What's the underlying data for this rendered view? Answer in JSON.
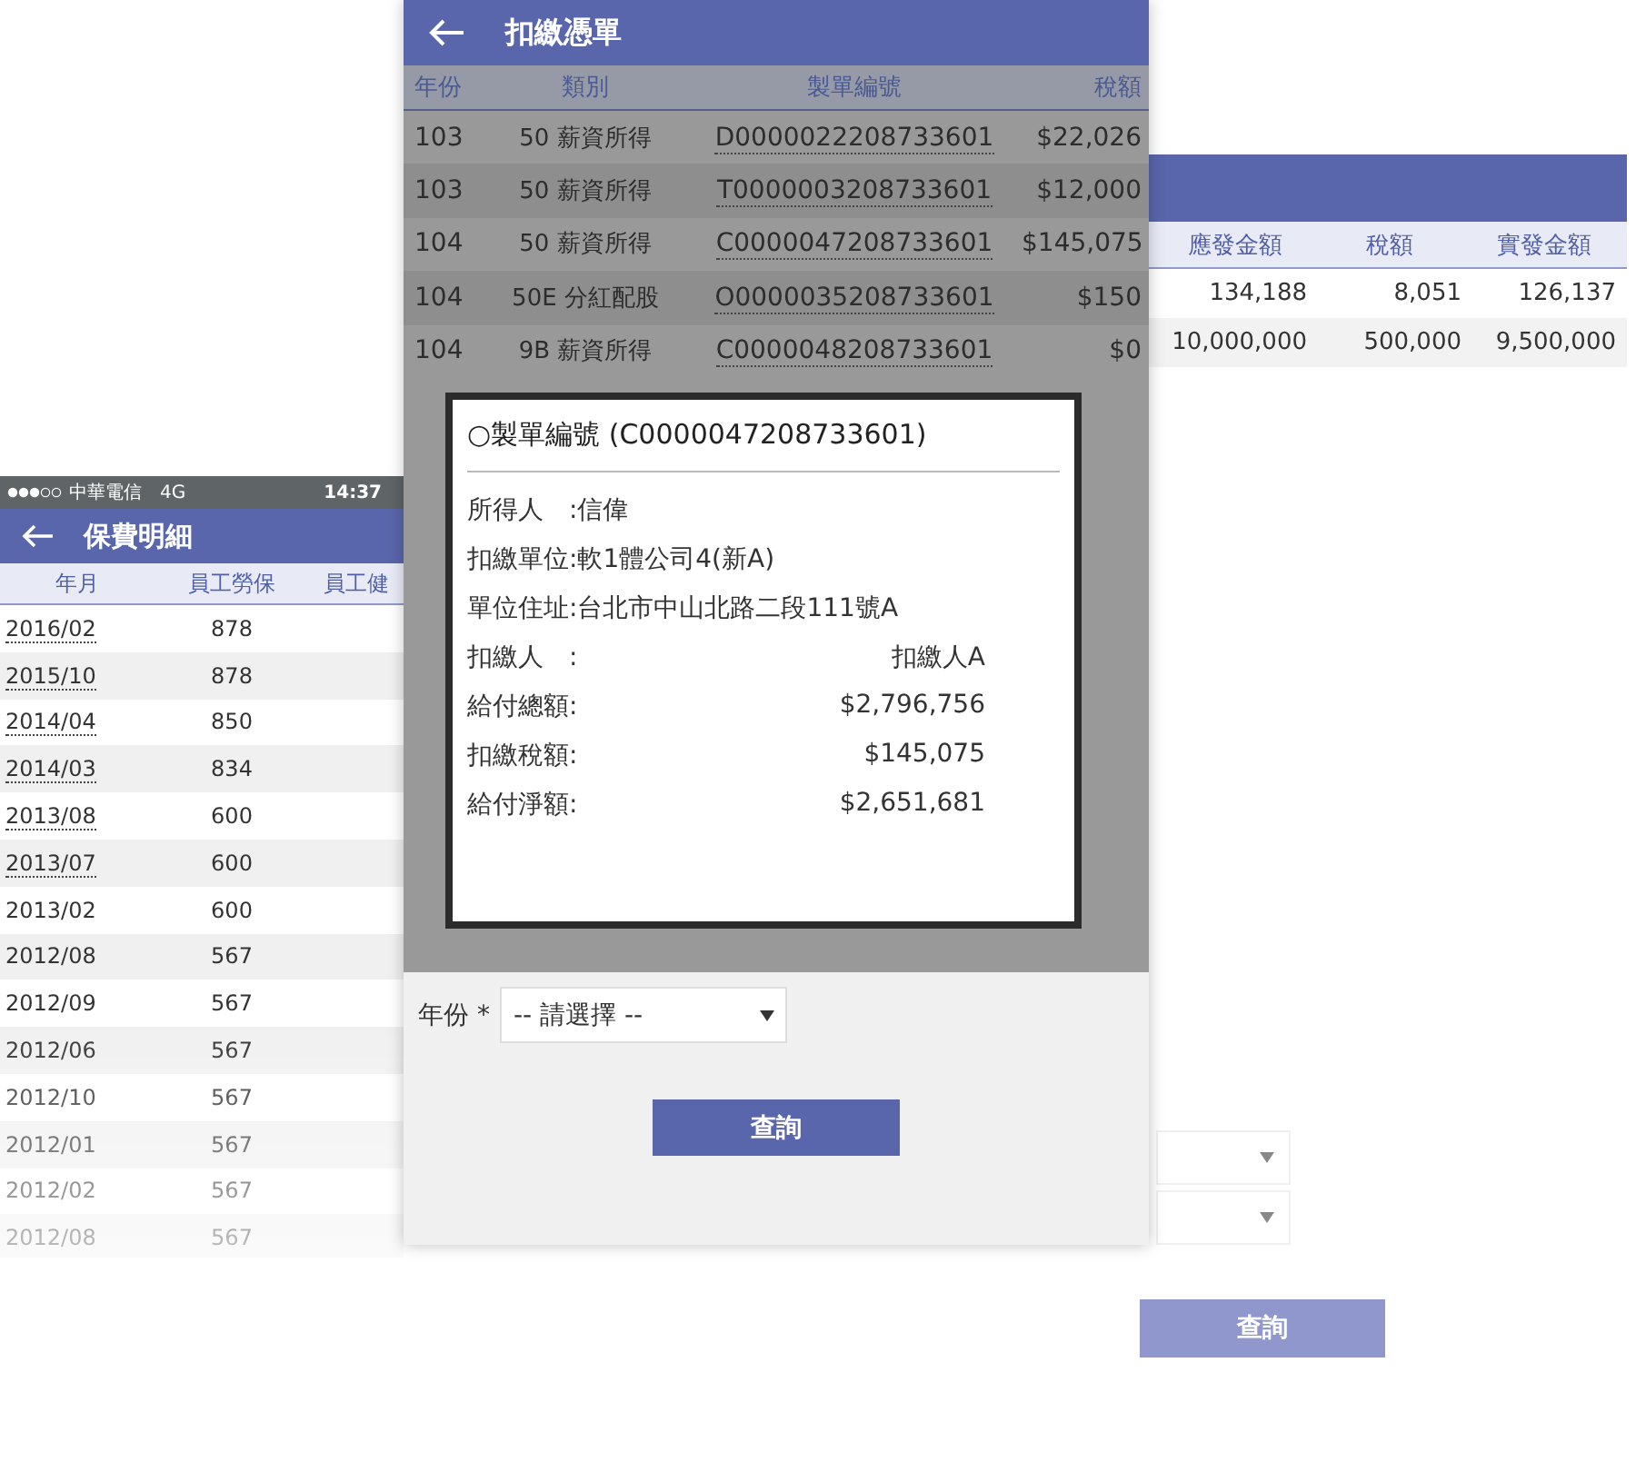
{
  "left_screen": {
    "status_bar": {
      "carrier": "中華電信",
      "network": "4G",
      "time": "14:37"
    },
    "title": "保費明細",
    "columns": [
      "年月",
      "員工勞保",
      "員工健"
    ],
    "rows": [
      {
        "month": "2016/02",
        "amount": "878",
        "link": true
      },
      {
        "month": "2015/10",
        "amount": "878",
        "link": true
      },
      {
        "month": "2014/04",
        "amount": "850",
        "link": true
      },
      {
        "month": "2014/03",
        "amount": "834",
        "link": true
      },
      {
        "month": "2013/08",
        "amount": "600",
        "link": true
      },
      {
        "month": "2013/07",
        "amount": "600",
        "link": true
      },
      {
        "month": "2013/02",
        "amount": "600",
        "link": false
      },
      {
        "month": "2012/08",
        "amount": "567",
        "link": false
      },
      {
        "month": "2012/09",
        "amount": "567",
        "link": false
      },
      {
        "month": "2012/06",
        "amount": "567",
        "link": false
      },
      {
        "month": "2012/10",
        "amount": "567",
        "link": false
      },
      {
        "month": "2012/01",
        "amount": "567",
        "link": false
      },
      {
        "month": "2012/02",
        "amount": "567",
        "link": false
      },
      {
        "month": "2012/08",
        "amount": "567",
        "link": false
      }
    ]
  },
  "right_screen": {
    "columns": [
      "應發金額",
      "稅額",
      "實發金額"
    ],
    "rows": [
      [
        "134,188",
        "8,051",
        "126,137"
      ],
      [
        "10,000,000",
        "500,000",
        "9,500,000"
      ]
    ],
    "filters": [
      {
        "kind": "select"
      },
      {
        "kind": "select"
      }
    ],
    "button": "查詢"
  },
  "middle_screen": {
    "title": "扣繳憑單",
    "columns": [
      "年份",
      "類別",
      "製單編號",
      "稅額"
    ],
    "rows": [
      {
        "year": "103",
        "category": "50 薪資所得",
        "number": "D0000022208733601",
        "tax": "$22,026"
      },
      {
        "year": "103",
        "category": "50 薪資所得",
        "number": "T0000003208733601",
        "tax": "$12,000"
      },
      {
        "year": "104",
        "category": "50 薪資所得",
        "number": "C0000047208733601",
        "tax": "$145,075"
      },
      {
        "year": "104",
        "category": "50E 分紅配股",
        "number": "O0000035208733601",
        "tax": "$150"
      },
      {
        "year": "104",
        "category": "9B 薪資所得",
        "number": "C0000048208733601",
        "tax": "$0"
      }
    ],
    "dialog": {
      "title": "○製單編號 (C0000047208733601)",
      "lines": [
        {
          "kind": "inline",
          "label": "所得人　:信偉"
        },
        {
          "kind": "inline",
          "label": "扣繳單位:軟1體公司4(新A)"
        },
        {
          "kind": "inline",
          "label": "單位住址:台北市中山北路二段111號A"
        },
        {
          "kind": "split",
          "label": "扣繳人　:",
          "value": "扣繳人A"
        },
        {
          "kind": "split",
          "label": "給付總額:",
          "value": "$2,796,756"
        },
        {
          "kind": "split",
          "label": "扣繳稅額:",
          "value": "$145,075"
        },
        {
          "kind": "split",
          "label": "給付淨額:",
          "value": "$2,651,681"
        }
      ]
    },
    "form": {
      "label": "年份 *",
      "select": "-- 請選擇 --",
      "button": "查詢"
    }
  }
}
